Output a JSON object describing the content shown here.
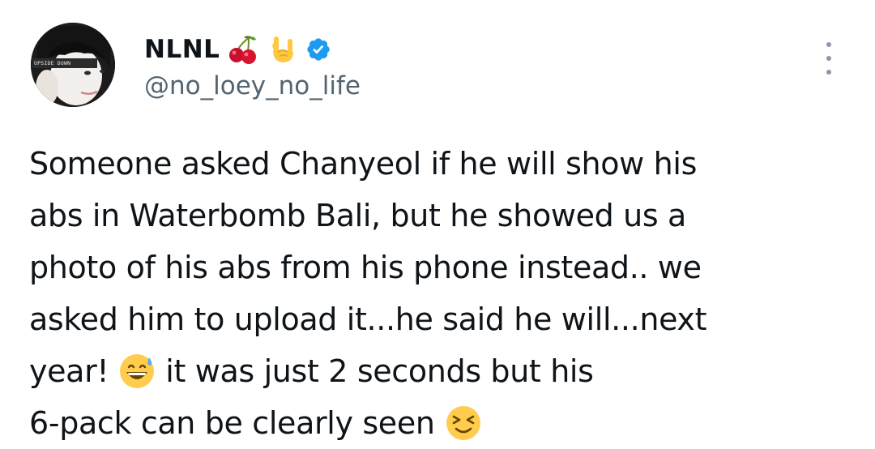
{
  "tweet": {
    "author": {
      "display_name": "NLNL",
      "name_emojis": [
        "cherry-emoji",
        "rock-on-hand-emoji"
      ],
      "verified": true,
      "verified_color": "#1d9bf0",
      "handle": "@no_loey_no_life",
      "avatar_text": "UPSIDE DOWN"
    },
    "more_icon": "more-vertical-icon",
    "lines": [
      {
        "text": "Someone asked Chanyeol if he will show his"
      },
      {
        "text": "abs in Waterbomb Bali, but he showed us a"
      },
      {
        "text": "photo of his abs from his phone instead.. we"
      },
      {
        "text": "asked him to upload it...he said he will...next"
      },
      {
        "before": "year!",
        "emoji": "grinning-sweat-emoji",
        "after": "it was just 2 seconds but his"
      },
      {
        "before": "6-pack can be clearly seen",
        "emoji": "squinting-face-emoji"
      }
    ]
  },
  "colors": {
    "text": "#0f1419",
    "secondary_text": "#536471",
    "background": "#ffffff"
  }
}
